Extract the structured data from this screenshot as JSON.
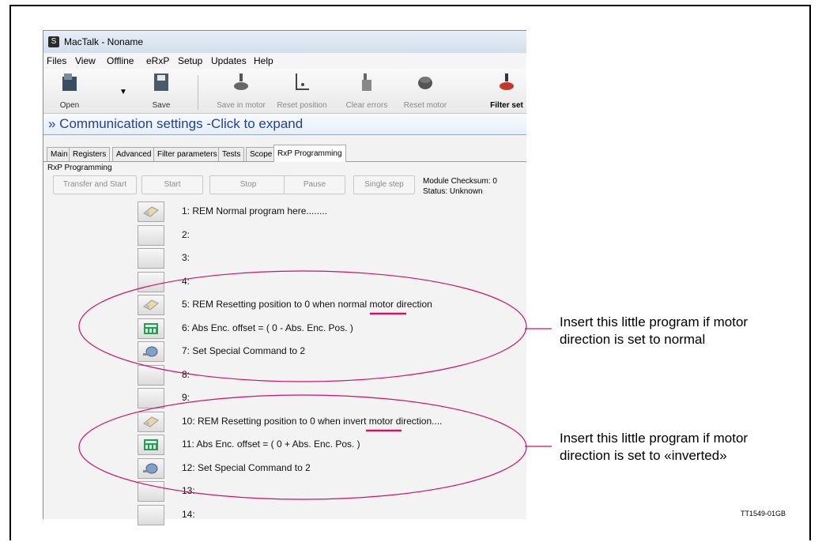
{
  "window": {
    "title": "MacTalk - Noname"
  },
  "menu": [
    "Files",
    "View",
    "Offline",
    "eRxP",
    "Setup",
    "Updates",
    "Help"
  ],
  "toolbar": {
    "open": "Open",
    "save": "Save",
    "save_in_motor": "Save in motor",
    "reset_position": "Reset position",
    "clear_errors": "Clear errors",
    "reset_motor": "Reset motor",
    "filter_set": "Filter set"
  },
  "communication": "» Communication settings -Click to expand",
  "tabs": [
    "Main",
    "Registers",
    "Advanced",
    "Filter parameters",
    "Tests",
    "Scope",
    "RxP Programming"
  ],
  "active_tab": "RxP Programming",
  "group_label": "RxP Programming",
  "buttons": {
    "transfer_and_start": "Transfer and Start",
    "start": "Start",
    "stop": "Stop",
    "pause": "Pause",
    "single_step": "Single step"
  },
  "status": {
    "checksum": "Module Checksum: 0",
    "state": "Status: Unknown"
  },
  "program_lines": [
    {
      "text": "1: REM Normal program here........",
      "icon": "rem-icon"
    },
    {
      "text": "2:",
      "icon": ""
    },
    {
      "text": "3:",
      "icon": ""
    },
    {
      "text": "4:",
      "icon": ""
    },
    {
      "text": "5: REM Resetting position to 0 when normal motor direction",
      "icon": "rem-icon"
    },
    {
      "text": "6: Abs Enc. offset = ( 0 - Abs. Enc. Pos. )",
      "icon": "calculator-icon"
    },
    {
      "text": "7: Set Special Command to 2",
      "icon": "special-command-icon"
    },
    {
      "text": "8:",
      "icon": ""
    },
    {
      "text": "9:",
      "icon": ""
    },
    {
      "text": "10: REM Resetting position to 0 when invert motor direction....",
      "icon": "rem-icon"
    },
    {
      "text": "11: Abs Enc. offset = ( 0 + Abs. Enc. Pos. )",
      "icon": "calculator-icon"
    },
    {
      "text": "12: Set Special Command to 2",
      "icon": "special-command-icon"
    },
    {
      "text": "13:",
      "icon": ""
    },
    {
      "text": "14:",
      "icon": ""
    }
  ],
  "annotations": {
    "normal": [
      "Insert this little program if motor",
      "direction is set to normal"
    ],
    "inverted": [
      "Insert this little program if motor",
      "direction is set to «inverted»"
    ]
  },
  "doc_id": "TT1549-01GB",
  "colors": {
    "highlight": "#d0106a",
    "comm_text": "#1f3fa0"
  }
}
